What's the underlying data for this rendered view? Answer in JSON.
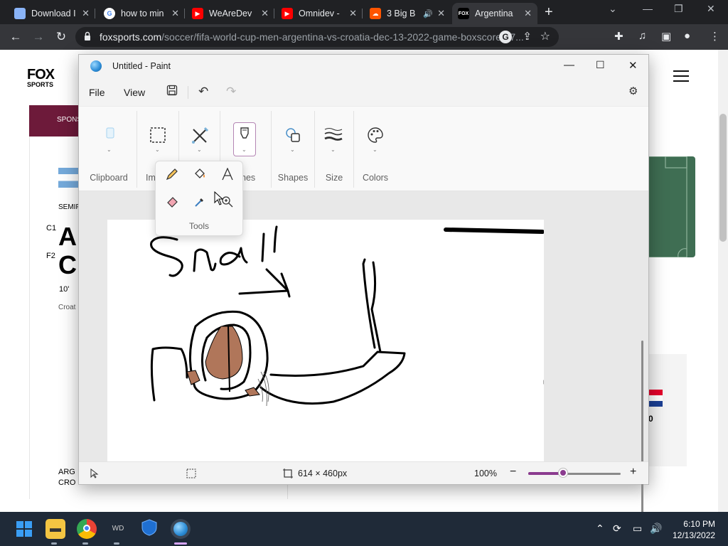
{
  "browser": {
    "tabs": [
      {
        "title": "Download I",
        "active": false
      },
      {
        "title": "how to min",
        "active": false
      },
      {
        "title": "WeAreDev",
        "active": false
      },
      {
        "title": "Omnidev -",
        "active": false
      },
      {
        "title": "3 Big B",
        "active": false
      },
      {
        "title": "Argentina",
        "active": true
      }
    ],
    "new_tab_symbol": "+",
    "url_domain": "foxsports.com",
    "url_path": "/soccer/fifa-world-cup-men-argentina-vs-croatia-dec-13-2022-game-boxscore-97...",
    "colors": {
      "tab_bg": "#202124",
      "toolbar_bg": "#35363a"
    }
  },
  "website": {
    "logo_line1": "FOX",
    "logo_line2": "SPORTS",
    "sponsor_text": "SPONS",
    "round_text": "SEMIF",
    "team1_seed": "C1",
    "team1_abbr": "AR",
    "team2_seed": "F2",
    "team2_abbr": "CR",
    "match_minute": "10'",
    "team_name_cut": "Croat",
    "score_row1": "ARG",
    "score_row2": "CRO",
    "side_score": "0"
  },
  "paint": {
    "title": "Untitled - Paint",
    "menu": {
      "file": "File",
      "view": "View"
    },
    "ribbon": {
      "clipboard": "Clipboard",
      "image_cut": "Im",
      "brushes_cut": "hes",
      "shapes": "Shapes",
      "size": "Size",
      "colors": "Colors"
    },
    "tools_flyout": {
      "label": "Tools"
    },
    "canvas_text": "Snail",
    "status": {
      "canvas_size": "614 × 460px",
      "zoom": "100%",
      "zoom_fraction": 0.38
    },
    "colors": {
      "accent": "#8b3b8f",
      "snail_shell": "#b0765a"
    }
  },
  "taskbar": {
    "time": "6:10 PM",
    "date": "12/13/2022"
  }
}
